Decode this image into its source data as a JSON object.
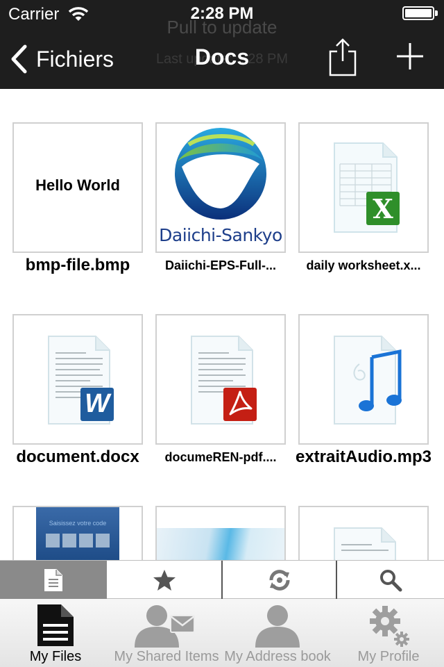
{
  "status_bar": {
    "carrier": "Carrier",
    "time": "2:28 PM"
  },
  "refresh_hint": {
    "pull": "Pull to update",
    "updated": "Last update: ...28 PM"
  },
  "nav": {
    "back_label": "Fichiers",
    "title": "Docs"
  },
  "files": [
    {
      "name": "bmp-file.bmp",
      "preview_text": "Hello World",
      "kind": "image"
    },
    {
      "name": "Daiichi-EPS-Full-...",
      "preview_text": "Daiichi-Sankyo",
      "kind": "logo"
    },
    {
      "name": "daily worksheet.x...",
      "badge": "X",
      "kind": "excel"
    },
    {
      "name": "document.docx",
      "badge": "W",
      "kind": "word"
    },
    {
      "name": "documeREN-pdf....",
      "kind": "pdf"
    },
    {
      "name": "extraitAudio.mp3",
      "kind": "audio"
    },
    {
      "name": "",
      "preview_text": "Saisissez votre code",
      "kind": "screenshot"
    },
    {
      "name": "",
      "kind": "image"
    },
    {
      "name": "",
      "kind": "document"
    }
  ],
  "filter_tabs": [
    {
      "icon": "document-icon",
      "selected": true
    },
    {
      "icon": "star-icon",
      "selected": false
    },
    {
      "icon": "sync-icon",
      "selected": false
    },
    {
      "icon": "search-icon",
      "selected": false
    }
  ],
  "tabs": [
    {
      "label": "My Files",
      "icon": "files-icon",
      "active": true
    },
    {
      "label": "My Shared Items",
      "icon": "shared-user-icon",
      "active": false
    },
    {
      "label": "My Address book",
      "icon": "contact-icon",
      "active": false
    },
    {
      "label": "My Profile",
      "icon": "gear-icon",
      "active": false
    }
  ],
  "colors": {
    "nav_bg": "#1e1e1e",
    "excel_green": "#2f8f2a",
    "word_blue": "#1f5c9e",
    "pdf_red": "#c41f14",
    "audio_blue": "#1a73d6"
  }
}
